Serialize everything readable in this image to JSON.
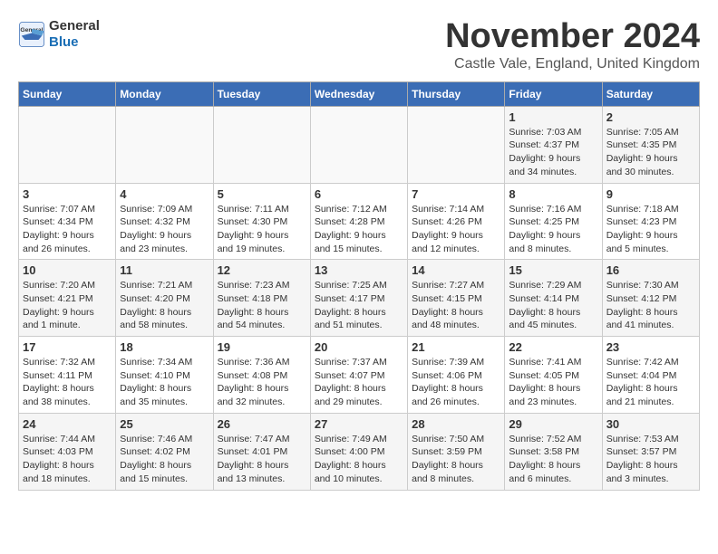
{
  "header": {
    "logo_general": "General",
    "logo_blue": "Blue",
    "month_title": "November 2024",
    "subtitle": "Castle Vale, England, United Kingdom"
  },
  "columns": [
    "Sunday",
    "Monday",
    "Tuesday",
    "Wednesday",
    "Thursday",
    "Friday",
    "Saturday"
  ],
  "weeks": [
    [
      {
        "day": "",
        "info": ""
      },
      {
        "day": "",
        "info": ""
      },
      {
        "day": "",
        "info": ""
      },
      {
        "day": "",
        "info": ""
      },
      {
        "day": "",
        "info": ""
      },
      {
        "day": "1",
        "info": "Sunrise: 7:03 AM\nSunset: 4:37 PM\nDaylight: 9 hours and 34 minutes."
      },
      {
        "day": "2",
        "info": "Sunrise: 7:05 AM\nSunset: 4:35 PM\nDaylight: 9 hours and 30 minutes."
      }
    ],
    [
      {
        "day": "3",
        "info": "Sunrise: 7:07 AM\nSunset: 4:34 PM\nDaylight: 9 hours and 26 minutes."
      },
      {
        "day": "4",
        "info": "Sunrise: 7:09 AM\nSunset: 4:32 PM\nDaylight: 9 hours and 23 minutes."
      },
      {
        "day": "5",
        "info": "Sunrise: 7:11 AM\nSunset: 4:30 PM\nDaylight: 9 hours and 19 minutes."
      },
      {
        "day": "6",
        "info": "Sunrise: 7:12 AM\nSunset: 4:28 PM\nDaylight: 9 hours and 15 minutes."
      },
      {
        "day": "7",
        "info": "Sunrise: 7:14 AM\nSunset: 4:26 PM\nDaylight: 9 hours and 12 minutes."
      },
      {
        "day": "8",
        "info": "Sunrise: 7:16 AM\nSunset: 4:25 PM\nDaylight: 9 hours and 8 minutes."
      },
      {
        "day": "9",
        "info": "Sunrise: 7:18 AM\nSunset: 4:23 PM\nDaylight: 9 hours and 5 minutes."
      }
    ],
    [
      {
        "day": "10",
        "info": "Sunrise: 7:20 AM\nSunset: 4:21 PM\nDaylight: 9 hours and 1 minute."
      },
      {
        "day": "11",
        "info": "Sunrise: 7:21 AM\nSunset: 4:20 PM\nDaylight: 8 hours and 58 minutes."
      },
      {
        "day": "12",
        "info": "Sunrise: 7:23 AM\nSunset: 4:18 PM\nDaylight: 8 hours and 54 minutes."
      },
      {
        "day": "13",
        "info": "Sunrise: 7:25 AM\nSunset: 4:17 PM\nDaylight: 8 hours and 51 minutes."
      },
      {
        "day": "14",
        "info": "Sunrise: 7:27 AM\nSunset: 4:15 PM\nDaylight: 8 hours and 48 minutes."
      },
      {
        "day": "15",
        "info": "Sunrise: 7:29 AM\nSunset: 4:14 PM\nDaylight: 8 hours and 45 minutes."
      },
      {
        "day": "16",
        "info": "Sunrise: 7:30 AM\nSunset: 4:12 PM\nDaylight: 8 hours and 41 minutes."
      }
    ],
    [
      {
        "day": "17",
        "info": "Sunrise: 7:32 AM\nSunset: 4:11 PM\nDaylight: 8 hours and 38 minutes."
      },
      {
        "day": "18",
        "info": "Sunrise: 7:34 AM\nSunset: 4:10 PM\nDaylight: 8 hours and 35 minutes."
      },
      {
        "day": "19",
        "info": "Sunrise: 7:36 AM\nSunset: 4:08 PM\nDaylight: 8 hours and 32 minutes."
      },
      {
        "day": "20",
        "info": "Sunrise: 7:37 AM\nSunset: 4:07 PM\nDaylight: 8 hours and 29 minutes."
      },
      {
        "day": "21",
        "info": "Sunrise: 7:39 AM\nSunset: 4:06 PM\nDaylight: 8 hours and 26 minutes."
      },
      {
        "day": "22",
        "info": "Sunrise: 7:41 AM\nSunset: 4:05 PM\nDaylight: 8 hours and 23 minutes."
      },
      {
        "day": "23",
        "info": "Sunrise: 7:42 AM\nSunset: 4:04 PM\nDaylight: 8 hours and 21 minutes."
      }
    ],
    [
      {
        "day": "24",
        "info": "Sunrise: 7:44 AM\nSunset: 4:03 PM\nDaylight: 8 hours and 18 minutes."
      },
      {
        "day": "25",
        "info": "Sunrise: 7:46 AM\nSunset: 4:02 PM\nDaylight: 8 hours and 15 minutes."
      },
      {
        "day": "26",
        "info": "Sunrise: 7:47 AM\nSunset: 4:01 PM\nDaylight: 8 hours and 13 minutes."
      },
      {
        "day": "27",
        "info": "Sunrise: 7:49 AM\nSunset: 4:00 PM\nDaylight: 8 hours and 10 minutes."
      },
      {
        "day": "28",
        "info": "Sunrise: 7:50 AM\nSunset: 3:59 PM\nDaylight: 8 hours and 8 minutes."
      },
      {
        "day": "29",
        "info": "Sunrise: 7:52 AM\nSunset: 3:58 PM\nDaylight: 8 hours and 6 minutes."
      },
      {
        "day": "30",
        "info": "Sunrise: 7:53 AM\nSunset: 3:57 PM\nDaylight: 8 hours and 3 minutes."
      }
    ]
  ]
}
